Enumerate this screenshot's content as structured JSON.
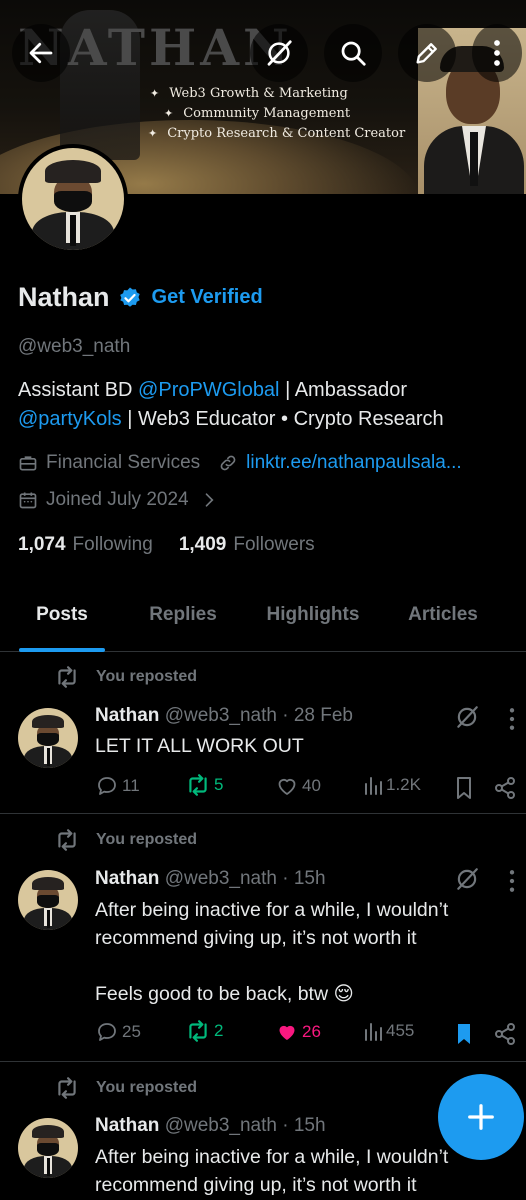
{
  "banner": {
    "title": "NATHAN",
    "bullets": [
      "Web3 Growth & Marketing",
      "Community Management",
      "Crypto Research & Content Creator"
    ],
    "bullet_symbol": "✦"
  },
  "topbar": {
    "icons": [
      "back-arrow-icon",
      "grok-icon",
      "search-icon",
      "edit-icon",
      "more-vertical-icon"
    ]
  },
  "profile": {
    "name": "Nathan",
    "verified_cta": "Get Verified",
    "handle": "@web3_nath",
    "bio": {
      "part1": "Assistant BD ",
      "mention1": "@ProPWGlobal",
      "part2": " | Ambassador ",
      "mention2": "@partyKols",
      "part3": " | Web3 Educator • Crypto Research"
    },
    "category": "Financial Services",
    "link": "linktr.ee/nathanpaulsala...",
    "joined": "Joined July 2024",
    "following_count": "1,074",
    "following_label": "Following",
    "followers_count": "1,409",
    "followers_label": "Followers"
  },
  "tabs": [
    "Posts",
    "Replies",
    "Highlights",
    "Articles"
  ],
  "active_tab": "Posts",
  "posts": [
    {
      "repost_label": "You reposted",
      "name": "Nathan",
      "handle_time": "@web3_nath · 28 Feb",
      "text": [
        "LET IT ALL WORK OUT"
      ],
      "replies": "11",
      "reposts": "5",
      "likes": "40",
      "views": "1.2K"
    },
    {
      "repost_label": "You reposted",
      "name": "Nathan",
      "handle_time": "@web3_nath · 15h",
      "text": [
        "After being inactive for a while, I wouldn’t recommend giving up, it’s not worth it",
        "Feels good to be back, btw 😌"
      ],
      "replies": "25",
      "reposts": "2",
      "likes": "26",
      "views": "455"
    },
    {
      "repost_label": "You reposted",
      "name": "Nathan",
      "handle_time": "@web3_nath · 15h",
      "text": [
        "After being inactive for a while, I wouldn’t recommend giving up, it’s not worth it"
      ]
    }
  ],
  "colors": {
    "accent": "#1d9bf0",
    "repost_green": "#00ba7c",
    "like_pink": "#f91880",
    "muted": "#71767b",
    "background": "#000000"
  }
}
